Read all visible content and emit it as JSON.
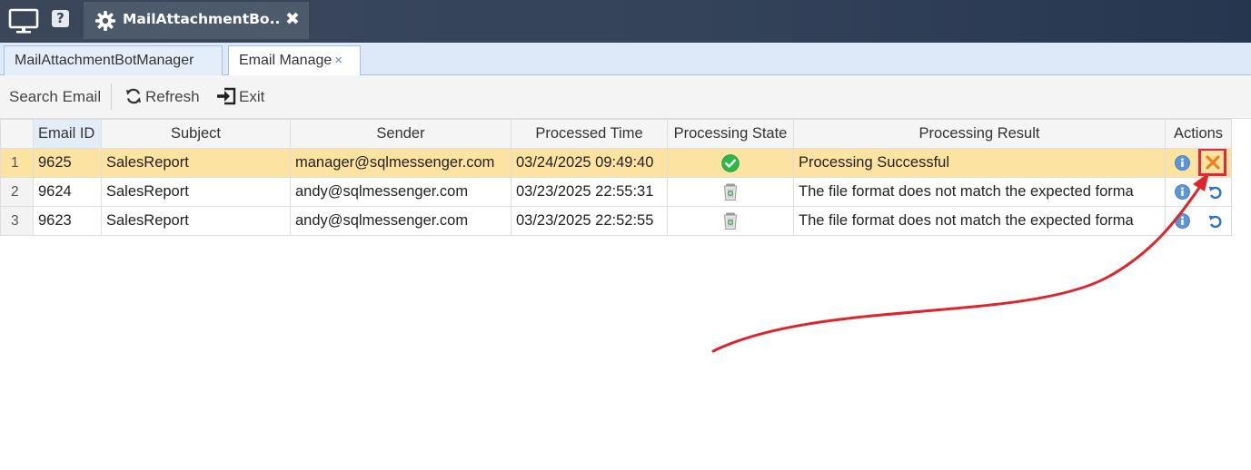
{
  "titlebar": {
    "app_tab_title": "MailAttachmentBo...",
    "help_label": "?",
    "close_label": "✖"
  },
  "doc_tabs": [
    {
      "label": "MailAttachmentBotManager"
    },
    {
      "label": "Email Manage",
      "close": "×"
    }
  ],
  "toolbar": {
    "search_label": "Search Email",
    "refresh_label": "Refresh",
    "exit_label": "Exit"
  },
  "grid": {
    "columns": [
      "Email ID",
      "Subject",
      "Sender",
      "Processed Time",
      "Processing State",
      "Processing Result",
      "Actions"
    ],
    "rows": [
      {
        "num": "1",
        "id": "9625",
        "subject": "SalesReport",
        "sender": "manager@sqlmessenger.com",
        "time": "03/24/2025 09:49:40",
        "state": "success",
        "result": "Processing Successful",
        "result_type": "ok",
        "action": "delete"
      },
      {
        "num": "2",
        "id": "9624",
        "subject": "SalesReport",
        "sender": "andy@sqlmessenger.com",
        "time": "03/23/2025 22:55:31",
        "state": "recycled",
        "result": "The file format does not match the expected forma",
        "result_type": "error",
        "action": "retry"
      },
      {
        "num": "3",
        "id": "9623",
        "subject": "SalesReport",
        "sender": "andy@sqlmessenger.com",
        "time": "03/23/2025 22:52:55",
        "state": "recycled",
        "result": "The file format does not match the expected forma",
        "result_type": "error",
        "action": "retry"
      }
    ]
  },
  "colors": {
    "titlebar": "#34435a",
    "selected_row": "#fde3a1",
    "link": "#3333cc",
    "error": "#e0242d",
    "annotation": "#e8243a"
  }
}
